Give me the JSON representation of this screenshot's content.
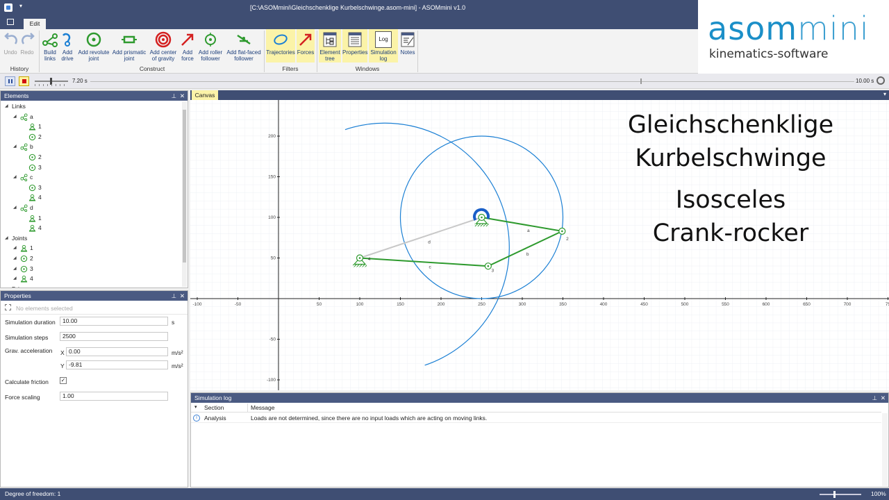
{
  "window": {
    "title": "[C:\\ASOMmini\\Gleichschenklige Kurbelschwinge.asom-mini] - ASOMmini v1.0",
    "menu_tab": "Edit"
  },
  "ribbon": {
    "history": {
      "label": "History",
      "undo": "Undo",
      "redo": "Redo"
    },
    "construct": {
      "label": "Construct",
      "items": [
        "Build\nlinks",
        "Add\ndrive",
        "Add revolute\njoint",
        "Add prismatic\njoint",
        "Add center\nof gravity",
        "Add\nforce",
        "Add roller\nfollower",
        "Add flat-faced\nfollower"
      ]
    },
    "filters": {
      "label": "Filters",
      "items": [
        "Trajectories",
        "Forces"
      ]
    },
    "windows": {
      "label": "Windows",
      "items": [
        "Element\ntree",
        "Properties",
        "Simulation\nlog",
        "Notes"
      ],
      "log_icon_text": "Log"
    }
  },
  "logo": {
    "brand_a": "asom",
    "brand_b": "mini",
    "tagline": "kinematics-software"
  },
  "timebar": {
    "current_time": "7.20 s",
    "end_time": "10.00 s",
    "progress": 0.72
  },
  "elements_panel": {
    "title": "Elements",
    "tree": [
      {
        "label": "Links",
        "level": 0
      },
      {
        "label": "a",
        "level": 1,
        "icon": "link"
      },
      {
        "label": "1",
        "level": 2,
        "icon": "ground"
      },
      {
        "label": "2",
        "level": 2,
        "icon": "rev"
      },
      {
        "label": "b",
        "level": 1,
        "icon": "link"
      },
      {
        "label": "2",
        "level": 2,
        "icon": "rev"
      },
      {
        "label": "3",
        "level": 2,
        "icon": "rev"
      },
      {
        "label": "c",
        "level": 1,
        "icon": "link"
      },
      {
        "label": "3",
        "level": 2,
        "icon": "rev"
      },
      {
        "label": "4",
        "level": 2,
        "icon": "ground"
      },
      {
        "label": "d",
        "level": 1,
        "icon": "link"
      },
      {
        "label": "1",
        "level": 2,
        "icon": "ground"
      },
      {
        "label": "4",
        "level": 2,
        "icon": "ground"
      },
      {
        "label": "Joints",
        "level": 0
      },
      {
        "label": "1",
        "level": 1,
        "icon": "ground"
      },
      {
        "label": "2",
        "level": 1,
        "icon": "rev"
      },
      {
        "label": "3",
        "level": 1,
        "icon": "rev"
      },
      {
        "label": "4",
        "level": 1,
        "icon": "ground"
      },
      {
        "label": "Drives",
        "level": 0
      }
    ]
  },
  "properties_panel": {
    "title": "Properties",
    "selection": "No elements selected",
    "sim_duration": {
      "label": "Simulation duration",
      "value": "10.00",
      "unit": "s"
    },
    "sim_steps": {
      "label": "Simulation steps",
      "value": "2500"
    },
    "grav": {
      "label": "Grav. acceleration",
      "x_label": "X",
      "x_value": "0.00",
      "y_label": "Y",
      "y_value": "-9.81",
      "unit": "m/s²"
    },
    "friction": {
      "label": "Calculate friction",
      "checked": true
    },
    "force_scaling": {
      "label": "Force scaling",
      "value": "1.00"
    }
  },
  "canvas": {
    "tab": "Canvas",
    "overlay": {
      "de": [
        "Gleichschenklige",
        "Kurbelschwinge"
      ],
      "en": [
        "Isosceles",
        "Crank-rocker"
      ]
    },
    "x_ticks": [
      "-100",
      "-50",
      "50",
      "100",
      "150",
      "200",
      "250",
      "300",
      "350",
      "400",
      "450",
      "500",
      "550",
      "600",
      "650",
      "700",
      "75"
    ],
    "y_ticks": [
      "200",
      "150",
      "100",
      "50",
      "-50",
      "-100"
    ],
    "link_labels": {
      "a": "a",
      "b": "b",
      "c": "c",
      "d": "d"
    },
    "joint_labels": {
      "2": "2",
      "3": "3",
      "4": "4"
    },
    "colors": {
      "link": "#2e9a2e",
      "trajectory": "#1a7fd4",
      "ground_link": "#c8c8c8"
    }
  },
  "sim_log": {
    "title": "Simulation log",
    "col_section": "Section",
    "col_message": "Message",
    "rows": [
      {
        "section": "Analysis",
        "message": "Loads are not determined, since there are no input loads which are acting on moving links."
      }
    ]
  },
  "status": {
    "dof": "Degree of freedom:  1",
    "zoom": "100%"
  }
}
